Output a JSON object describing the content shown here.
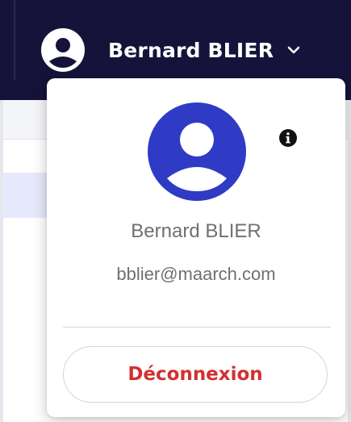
{
  "header": {
    "user_name": "Bernard BLIER",
    "avatar_icon": "user-circle-icon",
    "chevron_icon": "chevron-down-icon"
  },
  "dropdown": {
    "avatar_icon": "user-circle-icon",
    "info_icon": "info-icon",
    "name": "Bernard BLIER",
    "email": "bblier@maarch.com",
    "logout_label": "Déconnexion"
  },
  "colors": {
    "topbar_background": "#16133b",
    "avatar_blue": "#2f3bc5",
    "logout_text": "#d23030",
    "secondary_text": "#6f6f74"
  }
}
